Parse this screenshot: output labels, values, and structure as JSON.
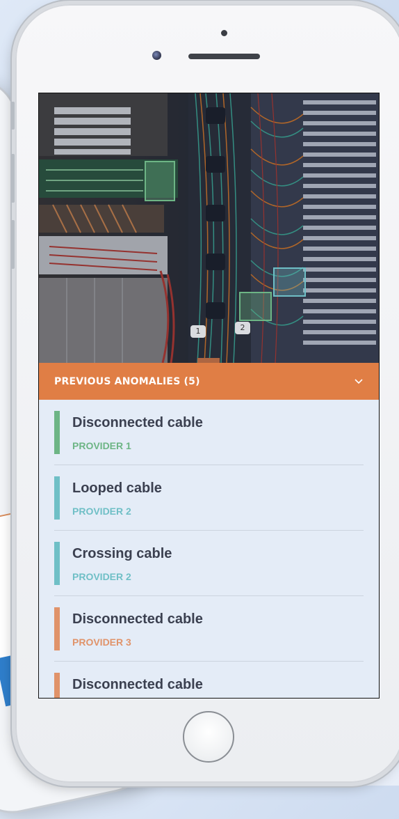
{
  "panel": {
    "title": "PREVIOUS ANOMALIES (5)",
    "accent_color": "#e07e45"
  },
  "anomalies": [
    {
      "title": "Disconnected cable",
      "provider": "PROVIDER 1",
      "color": "#6db585"
    },
    {
      "title": "Looped cable",
      "provider": "PROVIDER 2",
      "color": "#6fbfc6"
    },
    {
      "title": "Crossing cable",
      "provider": "PROVIDER 2",
      "color": "#6fbfc6"
    },
    {
      "title": "Disconnected cable",
      "provider": "PROVIDER 3",
      "color": "#e0936a"
    },
    {
      "title": "Disconnected cable",
      "provider": "",
      "color": "#e0936a"
    }
  ],
  "photo": {
    "rack_labels": [
      "1",
      "2"
    ]
  },
  "icons": {
    "expand": "chevron-down-icon"
  }
}
